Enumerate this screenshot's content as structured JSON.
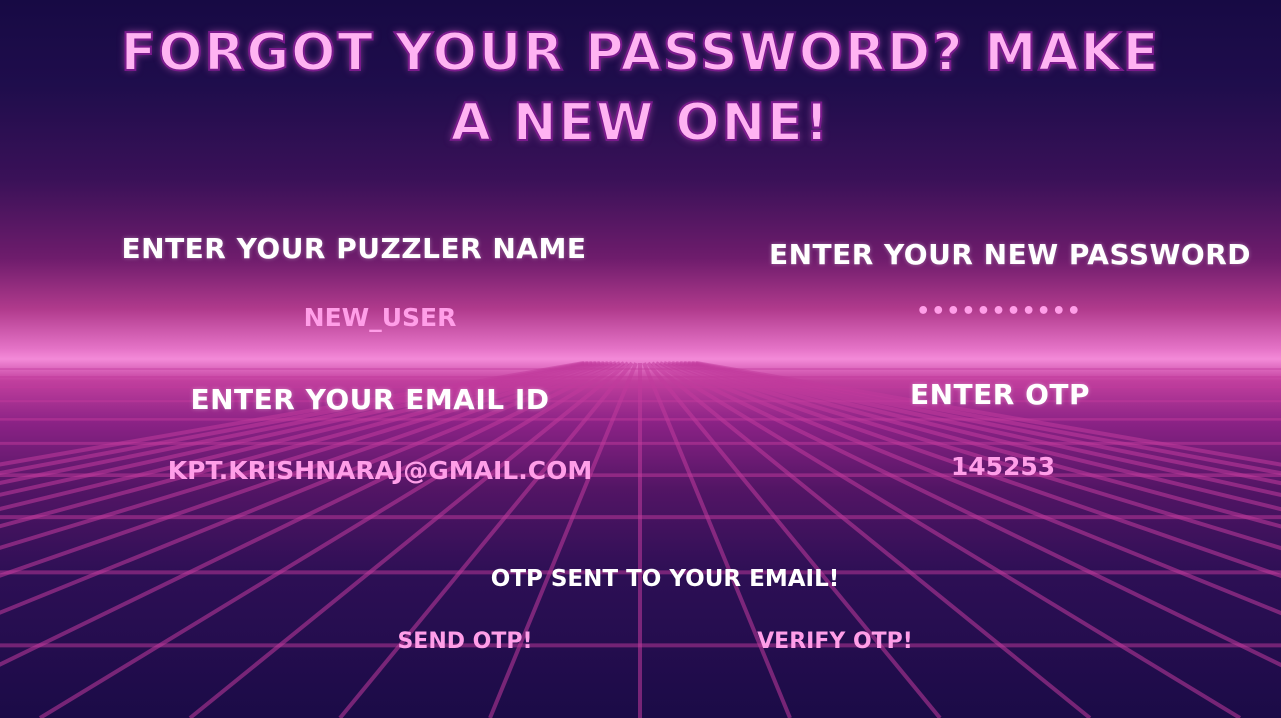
{
  "title": {
    "line1": "Forgot your password? Make",
    "line2": "a new one!"
  },
  "form": {
    "username_label": "Enter your puzzler name",
    "username_value": "new_user",
    "email_label": "Enter your email ID",
    "email_value": "kpt.krishnaraj@gmail.com",
    "password_label": "Enter your new password",
    "password_value": "•••••••••••",
    "otp_label": "Enter OTP",
    "otp_value": "145253"
  },
  "status_message": "OTP sent to your email!",
  "buttons": {
    "send_otp": "Send OTP!",
    "verify_otp": "Verify OTP!"
  },
  "colors": {
    "accent_pink": "#ff9ee8",
    "title_pink": "#ffb3f2",
    "label_white": "#ffffff",
    "grid_line": "#c13a9c",
    "sky_dark": "#170a44",
    "horizon_glow": "#f38ad8"
  }
}
